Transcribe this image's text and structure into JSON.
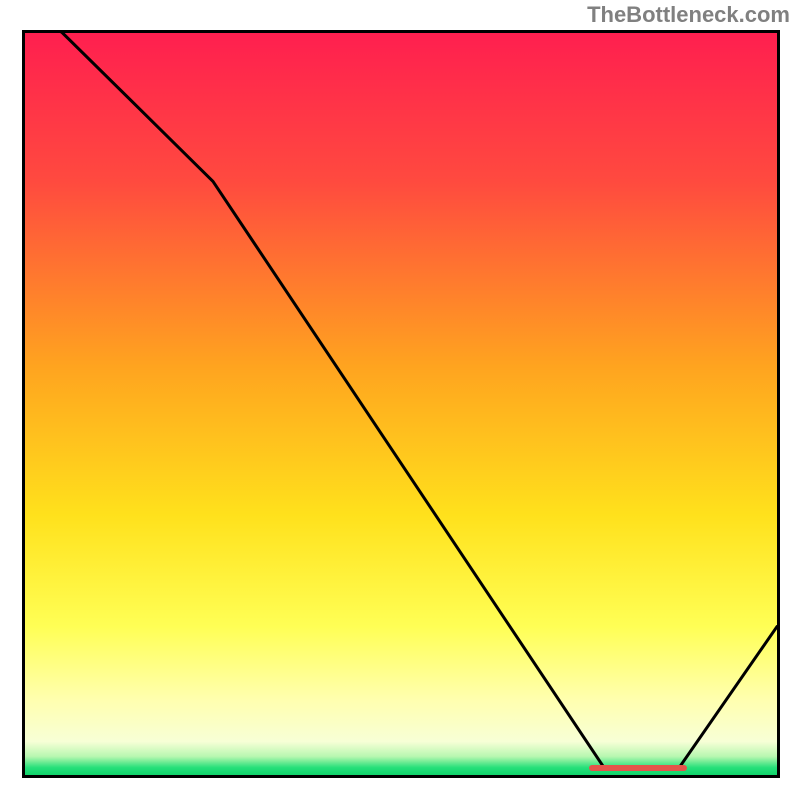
{
  "watermark": "TheBottleneck.com",
  "chart_data": {
    "type": "line",
    "title": "",
    "xlabel": "",
    "ylabel": "",
    "xlim": [
      0,
      100
    ],
    "ylim": [
      0,
      100
    ],
    "x": [
      0,
      5,
      25,
      77,
      87,
      100
    ],
    "values": [
      104,
      100,
      80,
      1,
      1,
      20
    ],
    "annotations": [
      {
        "type": "marker_strip",
        "x_start": 75,
        "x_end": 88,
        "y": 1
      }
    ],
    "background": {
      "type": "vertical_gradient",
      "stops": [
        {
          "offset": 0.0,
          "color": "#ff1f4f"
        },
        {
          "offset": 0.2,
          "color": "#ff4a3f"
        },
        {
          "offset": 0.45,
          "color": "#ffa41f"
        },
        {
          "offset": 0.65,
          "color": "#ffe11c"
        },
        {
          "offset": 0.8,
          "color": "#ffff55"
        },
        {
          "offset": 0.9,
          "color": "#ffffb0"
        },
        {
          "offset": 0.955,
          "color": "#f7ffd6"
        },
        {
          "offset": 0.975,
          "color": "#b8f7b0"
        },
        {
          "offset": 0.99,
          "color": "#26e07a"
        },
        {
          "offset": 1.0,
          "color": "#0fd36a"
        }
      ]
    }
  }
}
